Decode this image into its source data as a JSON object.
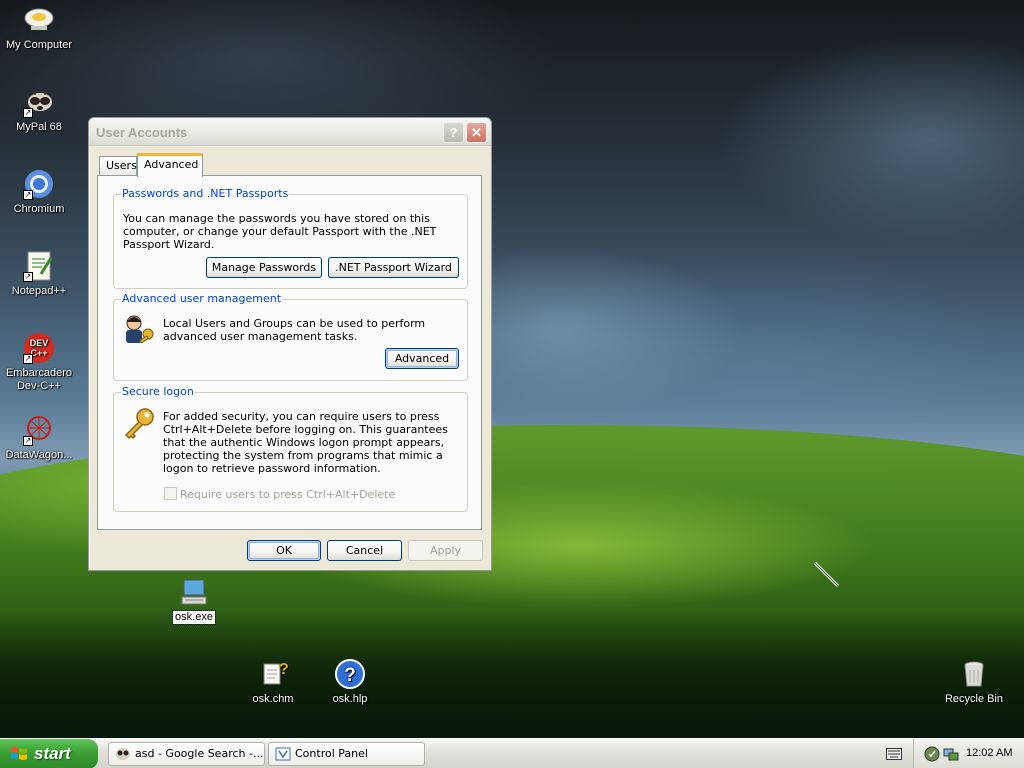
{
  "desktop": {
    "icons": [
      {
        "label": "My Computer"
      },
      {
        "label": "MyPal 68"
      },
      {
        "label": "Chromium"
      },
      {
        "label": "Notepad++"
      },
      {
        "label": "Embarcadero Dev-C++"
      },
      {
        "label": "DataWagon..."
      },
      {
        "label": "osk.exe"
      },
      {
        "label": "osk.chm"
      },
      {
        "label": "osk.hlp"
      },
      {
        "label": "Recycle Bin"
      }
    ],
    "notepad_icon_text": "++",
    "devcpp_icon_text": "DEV C++",
    "help_icon_text": "?"
  },
  "window": {
    "title": "User Accounts",
    "help_glyph": "?",
    "close_glyph": "✕",
    "tabs": [
      {
        "label": "Users",
        "active": false
      },
      {
        "label": "Advanced",
        "active": true
      }
    ],
    "passwords_group": {
      "title": "Passwords and .NET Passports",
      "text": "You can manage the passwords you have stored on this computer, or change your default Passport with the .NET Passport Wizard.",
      "manage_button": "Manage Passwords",
      "wizard_button": ".NET Passport Wizard"
    },
    "advanced_group": {
      "title": "Advanced user management",
      "text": "Local Users and Groups can be used to perform advanced user management tasks.",
      "advanced_button": "Advanced"
    },
    "secure_group": {
      "title": "Secure logon",
      "text": "For added security, you can require users to press Ctrl+Alt+Delete before logging on. This guarantees that the authentic Windows logon prompt appears, protecting the system from programs that mimic a logon to retrieve password information.",
      "checkbox_label": "Require users to press Ctrl+Alt+Delete",
      "checkbox_checked": false
    },
    "ok_button": "OK",
    "cancel_button": "Cancel",
    "apply_button": "Apply"
  },
  "taskbar": {
    "start_label": "start",
    "tasks": [
      {
        "label": "asd - Google Search -..."
      },
      {
        "label": "Control Panel"
      }
    ],
    "clock": "12:02 AM"
  },
  "colors": {
    "accent_blue": "#0046d5",
    "tab_highlight": "#f6b43b",
    "start_green": "#3a9f34"
  }
}
